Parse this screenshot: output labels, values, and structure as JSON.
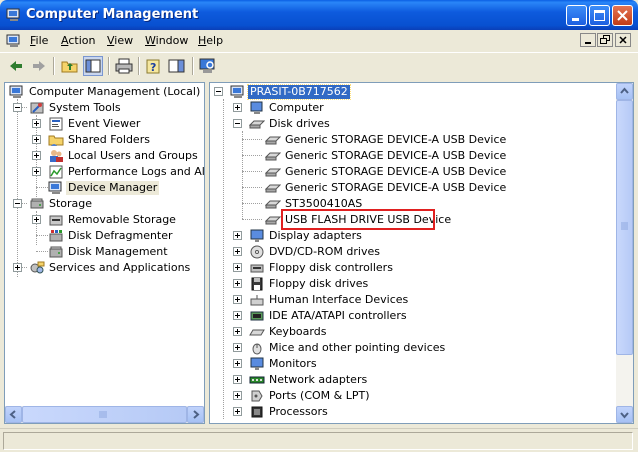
{
  "window": {
    "title": "Computer Management",
    "accent": "#0A5FE4"
  },
  "menu": [
    "File",
    "Action",
    "View",
    "Window",
    "Help"
  ],
  "menu_underline": [
    "F",
    "A",
    "V",
    "W",
    "H"
  ],
  "left_tree": [
    {
      "label": "Computer Management (Local)",
      "icon": "computer-management-icon"
    },
    {
      "label": "System Tools",
      "icon": "system-tools-icon"
    },
    {
      "label": "Event Viewer",
      "icon": "event-viewer-icon"
    },
    {
      "label": "Shared Folders",
      "icon": "shared-folders-icon"
    },
    {
      "label": "Local Users and Groups",
      "icon": "users-icon"
    },
    {
      "label": "Performance Logs and Alerts",
      "icon": "performance-icon"
    },
    {
      "label": "Device Manager",
      "icon": "device-manager-icon"
    },
    {
      "label": "Storage",
      "icon": "storage-icon"
    },
    {
      "label": "Removable Storage",
      "icon": "removable-storage-icon"
    },
    {
      "label": "Disk Defragmenter",
      "icon": "defrag-icon"
    },
    {
      "label": "Disk Management",
      "icon": "disk-management-icon"
    },
    {
      "label": "Services and Applications",
      "icon": "services-icon"
    }
  ],
  "right_tree": [
    {
      "label": "PRASIT-0B717562",
      "icon": "computer-icon"
    },
    {
      "label": "Computer",
      "icon": "computer-icon"
    },
    {
      "label": "Disk drives",
      "icon": "disk-drive-icon"
    },
    {
      "label": "Generic STORAGE DEVICE-A USB Device",
      "icon": "disk-drive-icon"
    },
    {
      "label": "Generic STORAGE DEVICE-A USB Device",
      "icon": "disk-drive-icon"
    },
    {
      "label": "Generic STORAGE DEVICE-A USB Device",
      "icon": "disk-drive-icon"
    },
    {
      "label": "Generic STORAGE DEVICE-A USB Device",
      "icon": "disk-drive-icon"
    },
    {
      "label": "ST3500410AS",
      "icon": "disk-drive-icon"
    },
    {
      "label": "USB FLASH DRIVE USB Device",
      "icon": "disk-drive-icon"
    },
    {
      "label": "Display adapters",
      "icon": "display-icon"
    },
    {
      "label": "DVD/CD-ROM drives",
      "icon": "cdrom-icon"
    },
    {
      "label": "Floppy disk controllers",
      "icon": "floppy-controller-icon"
    },
    {
      "label": "Floppy disk drives",
      "icon": "floppy-icon"
    },
    {
      "label": "Human Interface Devices",
      "icon": "hid-icon"
    },
    {
      "label": "IDE ATA/ATAPI controllers",
      "icon": "ide-icon"
    },
    {
      "label": "Keyboards",
      "icon": "keyboard-icon"
    },
    {
      "label": "Mice and other pointing devices",
      "icon": "mouse-icon"
    },
    {
      "label": "Monitors",
      "icon": "monitor-icon"
    },
    {
      "label": "Network adapters",
      "icon": "network-icon"
    },
    {
      "label": "Ports (COM & LPT)",
      "icon": "port-icon"
    },
    {
      "label": "Processors",
      "icon": "processor-icon"
    }
  ],
  "highlight_color": "#E02020",
  "selection_color": "#316AC5"
}
